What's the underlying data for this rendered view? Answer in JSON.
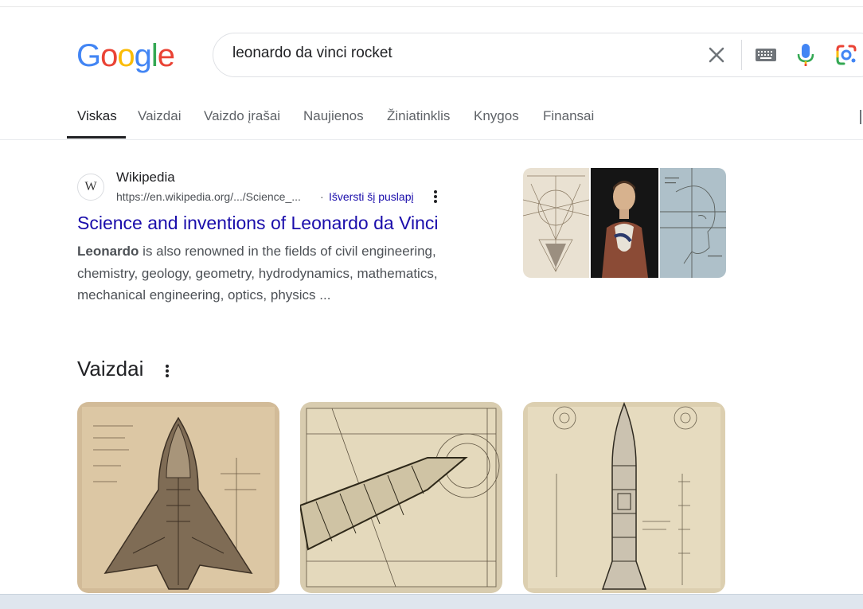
{
  "logo": {
    "letters": [
      "G",
      "o",
      "o",
      "g",
      "l",
      "e"
    ],
    "colors": [
      "#4285F4",
      "#EA4335",
      "#FBBC05",
      "#4285F4",
      "#34A853",
      "#EA4335"
    ]
  },
  "search": {
    "query": "leonardo da vinci rocket"
  },
  "tabs": [
    {
      "label": "Viskas",
      "active": true
    },
    {
      "label": "Vaizdai"
    },
    {
      "label": "Vaizdo įrašai"
    },
    {
      "label": "Naujienos"
    },
    {
      "label": "Žiniatinklis"
    },
    {
      "label": "Knygos"
    },
    {
      "label": "Finansai"
    }
  ],
  "result": {
    "favicon": "W",
    "site_name": "Wikipedia",
    "url": "https://en.wikipedia.org/.../Science_...",
    "separator": "·",
    "translate": "Išversti šį puslapį",
    "title": "Science and inventions of Leonardo da Vinci",
    "snippet_bold": "Leonardo",
    "snippet_rest": " is also renowned in the fields of civil engineering, chemistry, geology, geometry, hydrodynamics, mathematics, mechanical engineering, optics, physics ..."
  },
  "images_section": {
    "title": "Vaizdai"
  },
  "icons": {
    "clear": "close-icon",
    "keyboard": "keyboard-icon",
    "mic": "microphone-icon",
    "lens": "google-lens-icon",
    "more": "more-vert-icon"
  },
  "colors": {
    "link": "#1a0dab",
    "text": "#202124",
    "muted": "#4d5156",
    "sepia": "#d9c7a3"
  }
}
